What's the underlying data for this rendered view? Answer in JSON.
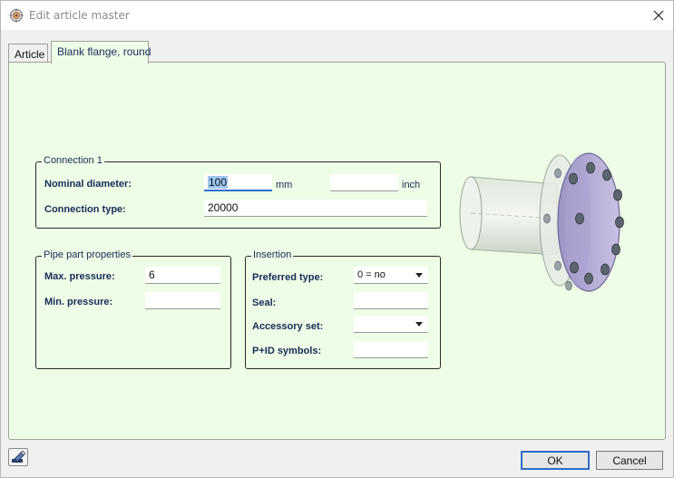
{
  "window": {
    "title": "Edit article master",
    "icons": {
      "app": "gear-wheel-icon",
      "close": "close-icon"
    }
  },
  "tabs": [
    {
      "label": "Article",
      "active": false
    },
    {
      "label": "Blank flange, round",
      "active": true
    }
  ],
  "connection": {
    "legend": "Connection 1",
    "nominal_diameter": {
      "label": "Nominal diameter:",
      "value": "100",
      "unit": "mm",
      "inch_value": "",
      "inch_unit": "inch"
    },
    "connection_type": {
      "label": "Connection type:",
      "value": "20000"
    }
  },
  "pipe_part": {
    "legend": "Pipe part properties",
    "max_pressure": {
      "label": "Max. pressure:",
      "value": "6"
    },
    "min_pressure": {
      "label": "Min. pressure:",
      "value": ""
    }
  },
  "insertion": {
    "legend": "Insertion",
    "preferred_type": {
      "label": "Preferred type:",
      "value": "0 = no"
    },
    "seal": {
      "label": "Seal:",
      "value": ""
    },
    "accessory_set": {
      "label": "Accessory set:",
      "value": ""
    },
    "pid_symbols": {
      "label": "P+ID symbols:",
      "value": ""
    }
  },
  "preview": {
    "icon": "blank-flange-3d-image"
  },
  "footer": {
    "edit_icon": "edit-pencil-icon",
    "ok_label": "OK",
    "cancel_label": "Cancel"
  },
  "colors": {
    "panel_bg": "#eefde6",
    "label_text": "#1a2a5a",
    "focus_accent": "#2b6fd1",
    "flange_face": "#b9b2d6"
  }
}
